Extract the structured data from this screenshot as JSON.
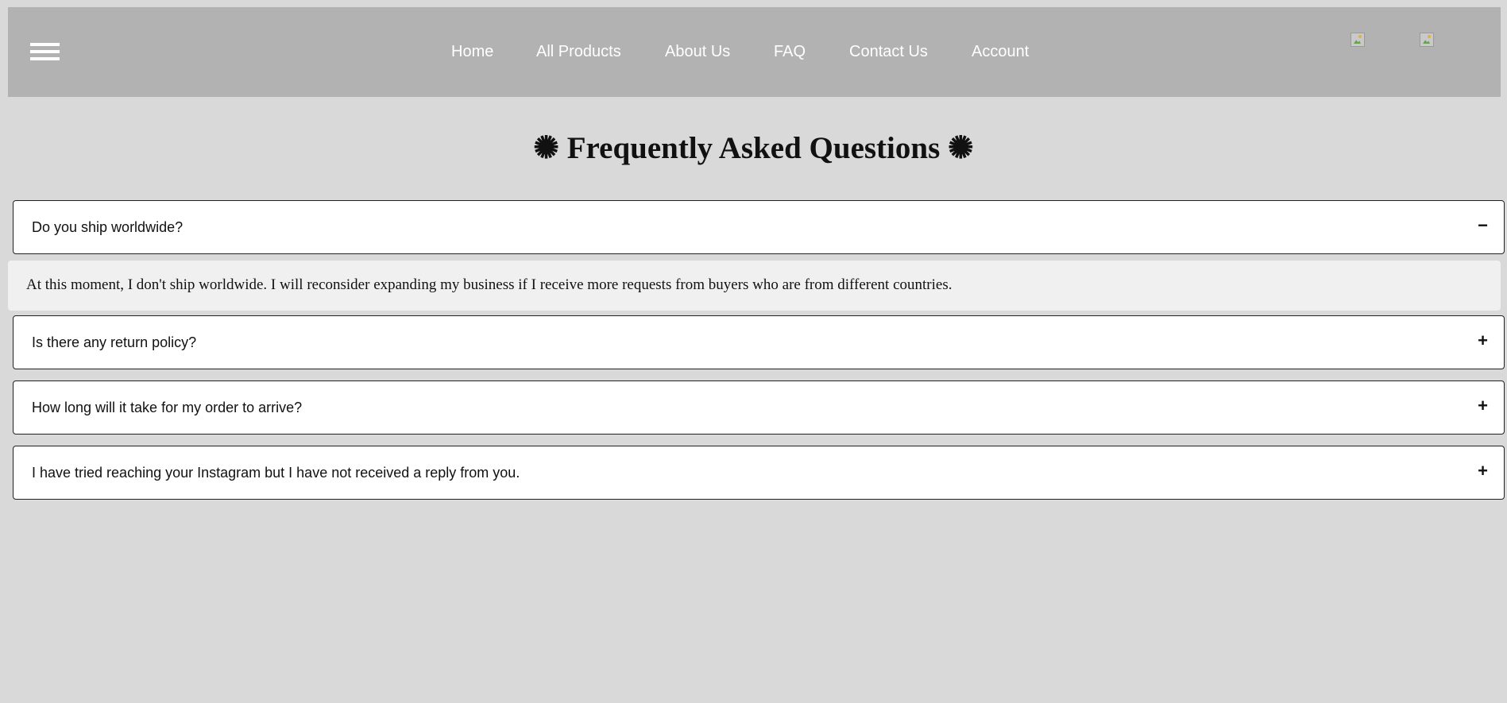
{
  "nav": {
    "menu_icon": "hamburger-menu-icon",
    "links": [
      "Home",
      "All Products",
      "About Us",
      "FAQ",
      "Contact Us",
      "Account"
    ],
    "icons": [
      "broken-image-icon",
      "broken-image-icon"
    ]
  },
  "page": {
    "title": "✺ Frequently Asked Questions ✺"
  },
  "faq": [
    {
      "question": "Do you ship worldwide?",
      "toggle": "−",
      "expanded": true,
      "answer": "At this moment, I don't ship worldwide. I will reconsider expanding my business if I receive more requests from buyers who are from different countries."
    },
    {
      "question": "Is there any return policy?",
      "toggle": "+",
      "expanded": false
    },
    {
      "question": "How long will it take for my order to arrive?",
      "toggle": "+",
      "expanded": false
    },
    {
      "question": "I have tried reaching your Instagram but I have not received a reply from you.",
      "toggle": "+",
      "expanded": false
    }
  ],
  "colors": {
    "page_bg": "#d9d9d9",
    "navbar_bg": "#b2b2b2",
    "nav_text": "#ffffff",
    "question_bg": "#ffffff",
    "answer_bg": "#f0f0f0"
  }
}
